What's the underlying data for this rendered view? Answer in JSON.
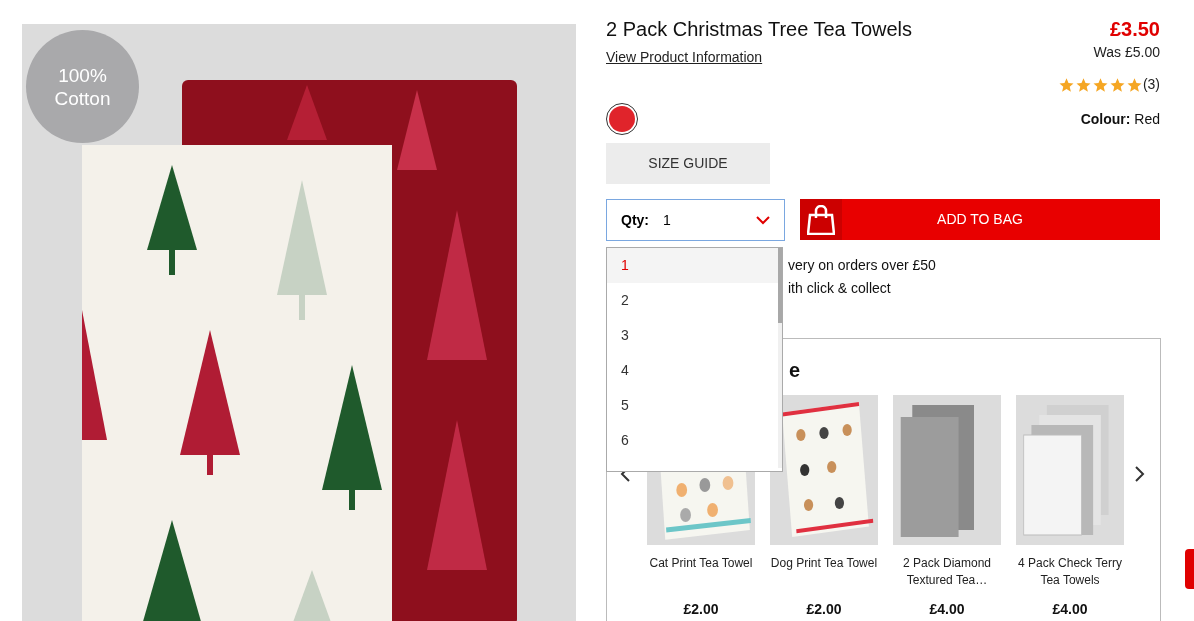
{
  "gallery": {
    "badge": [
      "100%",
      "Cotton"
    ]
  },
  "product": {
    "title": "2 Pack Christmas Tree Tea Towels",
    "info_link": "View Product Information",
    "price": "£3.50",
    "was_price": "Was £5.00",
    "stars": 5,
    "review_count": "(3)",
    "swatches": [
      {
        "color": "#e0242b",
        "selected": true
      }
    ],
    "colour_label": "Colour:",
    "colour_value": "Red",
    "size_guide": "SIZE GUIDE",
    "qty_label": "Qty:",
    "qty_value": "1",
    "add_to_bag": "ADD TO BAG",
    "qty_options": [
      {
        "label": "1",
        "selected": true
      },
      {
        "label": "2",
        "selected": false
      },
      {
        "label": "3",
        "selected": false
      },
      {
        "label": "4",
        "selected": false
      },
      {
        "label": "5",
        "selected": false
      },
      {
        "label": "6",
        "selected": false
      }
    ],
    "delivery_notes": [
      "very on orders over £50",
      "ith click & collect"
    ]
  },
  "recommendations": {
    "heading": "e",
    "items": [
      {
        "name": "Cat Print Tea Towel",
        "price": "£2.00",
        "kind": "cats"
      },
      {
        "name": "Dog Print Tea Towel",
        "price": "£2.00",
        "kind": "dogs"
      },
      {
        "name": "2 Pack Diamond Textured Tea…",
        "price": "£4.00",
        "kind": "grey"
      },
      {
        "name": "4 Pack Check Terry Tea Towels",
        "price": "£4.00",
        "kind": "check"
      }
    ]
  }
}
